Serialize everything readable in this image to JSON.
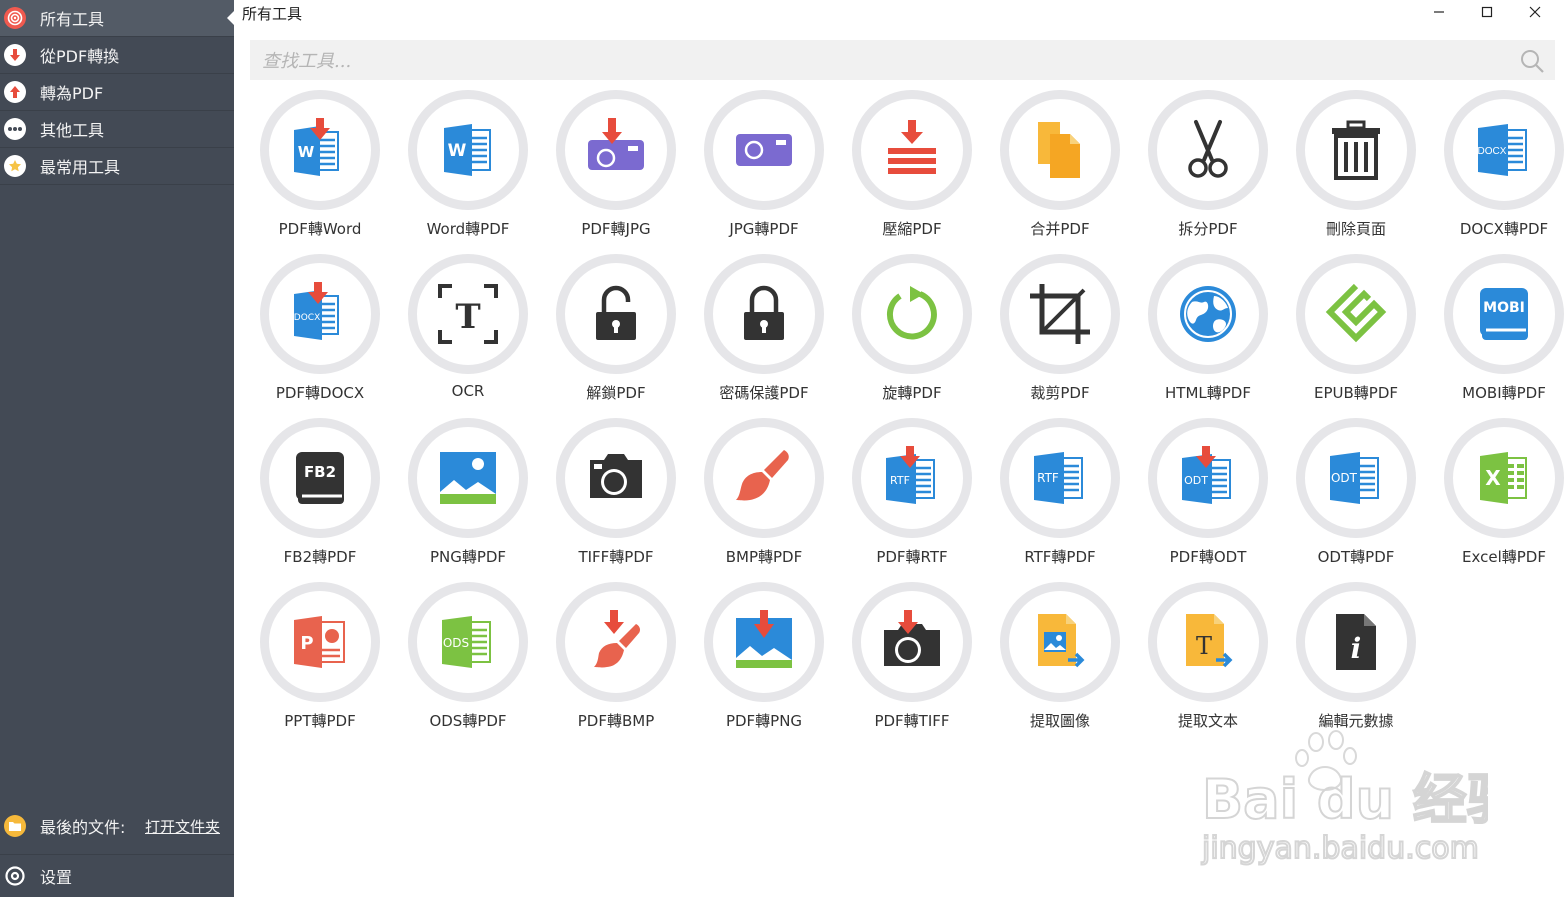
{
  "window": {
    "title": "所有工具"
  },
  "sidebar": {
    "items": [
      {
        "label": "所有工具",
        "icon": "target-icon",
        "color": "#f05a4f",
        "active": true
      },
      {
        "label": "從PDF轉換",
        "icon": "arrow-down-icon",
        "color": "#e74c3c"
      },
      {
        "label": "轉為PDF",
        "icon": "arrow-up-icon",
        "color": "#e74c3c"
      },
      {
        "label": "其他工具",
        "icon": "more-icon",
        "color": "#ffffff"
      },
      {
        "label": "最常用工具",
        "icon": "star-icon",
        "color": "#f6c344"
      }
    ],
    "recent_label": "最後的文件:",
    "open_folder": "打开文件夹",
    "settings": "设置"
  },
  "search": {
    "placeholder": "查找工具..."
  },
  "tools": [
    {
      "label": "PDF轉Word",
      "icon": "pdf-to-word-icon"
    },
    {
      "label": "Word轉PDF",
      "icon": "word-to-pdf-icon"
    },
    {
      "label": "PDF轉JPG",
      "icon": "pdf-to-jpg-icon"
    },
    {
      "label": "JPG轉PDF",
      "icon": "jpg-to-pdf-icon"
    },
    {
      "label": "壓縮PDF",
      "icon": "compress-icon"
    },
    {
      "label": "合并PDF",
      "icon": "merge-icon"
    },
    {
      "label": "拆分PDF",
      "icon": "scissors-icon"
    },
    {
      "label": "刪除頁面",
      "icon": "trash-icon"
    },
    {
      "label": "DOCX轉PDF",
      "icon": "docx-to-pdf-icon"
    },
    {
      "label": "PDF轉DOCX",
      "icon": "pdf-to-docx-icon"
    },
    {
      "label": "OCR",
      "icon": "ocr-icon"
    },
    {
      "label": "解鎖PDF",
      "icon": "unlock-icon"
    },
    {
      "label": "密碼保護PDF",
      "icon": "lock-icon"
    },
    {
      "label": "旋轉PDF",
      "icon": "rotate-icon"
    },
    {
      "label": "裁剪PDF",
      "icon": "crop-icon"
    },
    {
      "label": "HTML轉PDF",
      "icon": "globe-icon"
    },
    {
      "label": "EPUB轉PDF",
      "icon": "epub-icon"
    },
    {
      "label": "MOBI轉PDF",
      "icon": "mobi-icon"
    },
    {
      "label": "FB2轉PDF",
      "icon": "fb2-icon"
    },
    {
      "label": "PNG轉PDF",
      "icon": "png-icon"
    },
    {
      "label": "TIFF轉PDF",
      "icon": "camera-icon"
    },
    {
      "label": "BMP轉PDF",
      "icon": "brush-icon"
    },
    {
      "label": "PDF轉RTF",
      "icon": "pdf-to-rtf-icon"
    },
    {
      "label": "RTF轉PDF",
      "icon": "rtf-to-pdf-icon"
    },
    {
      "label": "PDF轉ODT",
      "icon": "pdf-to-odt-icon"
    },
    {
      "label": "ODT轉PDF",
      "icon": "odt-to-pdf-icon"
    },
    {
      "label": "Excel轉PDF",
      "icon": "excel-icon"
    },
    {
      "label": "PPT轉PDF",
      "icon": "ppt-icon"
    },
    {
      "label": "ODS轉PDF",
      "icon": "ods-icon"
    },
    {
      "label": "PDF轉BMP",
      "icon": "pdf-to-bmp-icon"
    },
    {
      "label": "PDF轉PNG",
      "icon": "pdf-to-png-icon"
    },
    {
      "label": "PDF轉TIFF",
      "icon": "pdf-to-tiff-icon"
    },
    {
      "label": "提取圖像",
      "icon": "extract-image-icon"
    },
    {
      "label": "提取文本",
      "icon": "extract-text-icon"
    },
    {
      "label": "編輯元數據",
      "icon": "metadata-icon"
    }
  ],
  "icon_text": {
    "word": "W",
    "docx": "DOCX",
    "mobi": "MOBI",
    "fb2": "FB2",
    "rtf": "RTF",
    "odt": "ODT",
    "excel": "X",
    "ppt": "P",
    "ods": "ODS",
    "ocr": "T",
    "text": "T",
    "info": "i"
  },
  "watermark": {
    "brand": "Bai du 经验",
    "url": "jingyan.baidu.com"
  },
  "colors": {
    "sidebar": "#434a55",
    "ring": "#e6e6e9",
    "blue": "#2b8ad9",
    "red": "#e74c3c"
  }
}
